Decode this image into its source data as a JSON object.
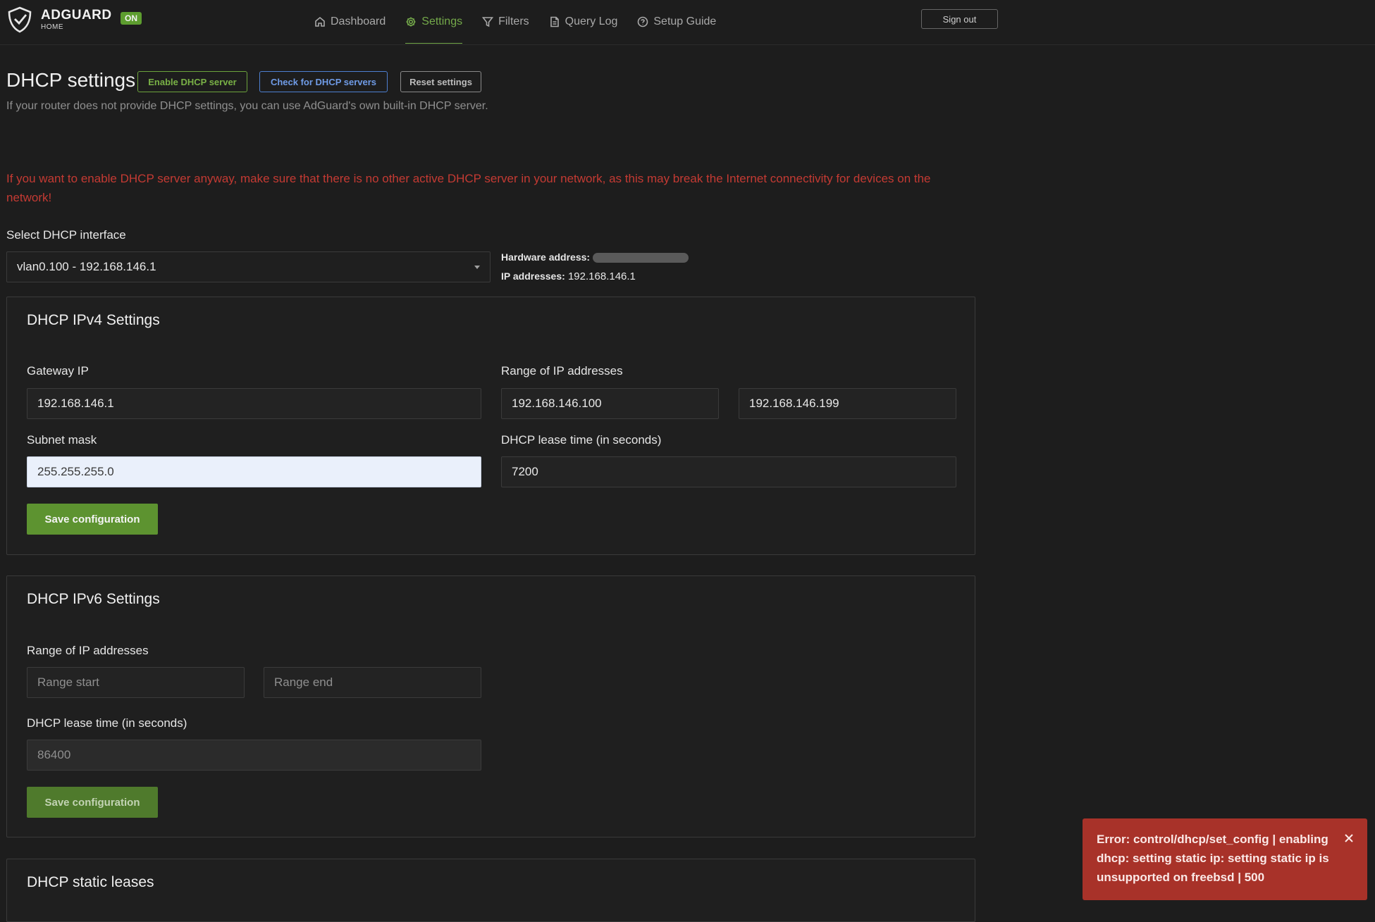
{
  "header": {
    "brand": "ADGUARD",
    "brand_sub": "HOME",
    "status_badge": "ON",
    "nav": [
      {
        "label": "Dashboard",
        "icon": "home-icon"
      },
      {
        "label": "Settings",
        "icon": "gear-icon",
        "active": true
      },
      {
        "label": "Filters",
        "icon": "filter-icon"
      },
      {
        "label": "Query Log",
        "icon": "document-icon"
      },
      {
        "label": "Setup Guide",
        "icon": "help-circle-icon"
      }
    ],
    "sign_out": "Sign out"
  },
  "page": {
    "title": "DHCP settings",
    "enable_button": "Enable DHCP server",
    "check_button": "Check for DHCP servers",
    "reset_button": "Reset settings",
    "subtitle": "If your router does not provide DHCP settings, you can use AdGuard's own built-in DHCP server.",
    "warning": "If you want to enable DHCP server anyway, make sure that there is no other active DHCP server in your network, as this may break the Internet connectivity for devices on the network!"
  },
  "interface": {
    "label": "Select DHCP interface",
    "selected": "vlan0.100 - 192.168.146.1",
    "hardware_label": "Hardware address:",
    "ip_label": "IP addresses:",
    "ip_value": "192.168.146.1"
  },
  "ipv4": {
    "title": "DHCP IPv4 Settings",
    "gateway_label": "Gateway IP",
    "gateway_value": "192.168.146.1",
    "range_label": "Range of IP addresses",
    "range_start": "192.168.146.100",
    "range_end": "192.168.146.199",
    "subnet_label": "Subnet mask",
    "subnet_value": "255.255.255.0",
    "lease_label": "DHCP lease time (in seconds)",
    "lease_value": "7200",
    "save_button": "Save configuration"
  },
  "ipv6": {
    "title": "DHCP IPv6 Settings",
    "range_label": "Range of IP addresses",
    "range_start_placeholder": "Range start",
    "range_end_placeholder": "Range end",
    "lease_label": "DHCP lease time (in seconds)",
    "lease_value": "86400",
    "save_button": "Save configuration"
  },
  "static_leases": {
    "title": "DHCP static leases"
  },
  "toast": {
    "message": "Error: control/dhcp/set_config | enabling dhcp: setting static ip: setting static ip is unsupported on freebsd | 500"
  },
  "colors": {
    "accent_green": "#74a94a",
    "warning_red": "#c43a33",
    "toast_red": "#a83229",
    "link_blue": "#6f9be6"
  }
}
